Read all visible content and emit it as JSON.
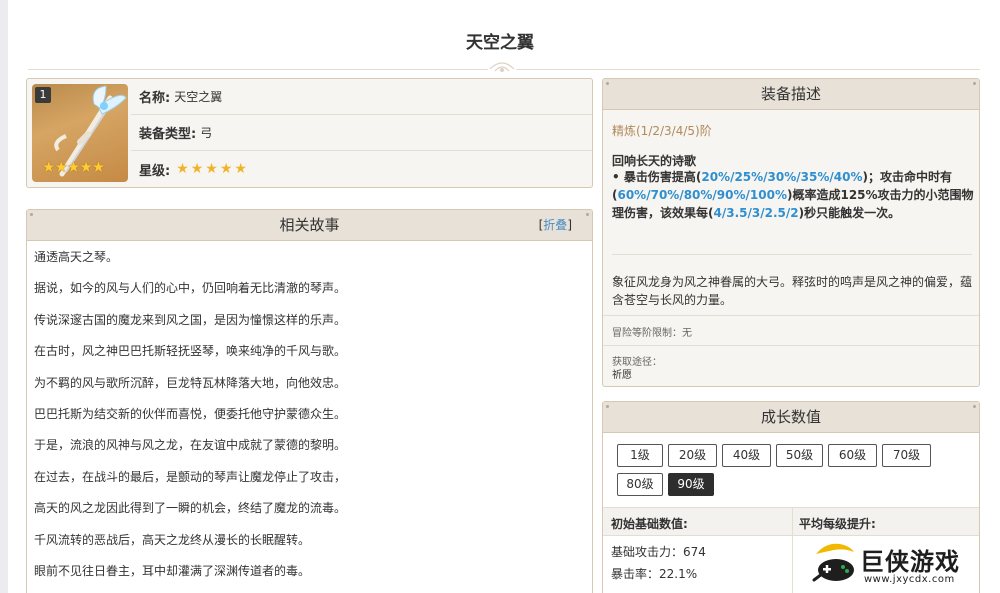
{
  "page": {
    "title": "天空之翼"
  },
  "info": {
    "level_badge": "1",
    "name_key": "名称:",
    "name_val": "天空之翼",
    "type_key": "装备类型:",
    "type_val": "弓",
    "star_key": "星级:",
    "stars": "★★★★★",
    "rarity": 5,
    "image_icon": "skyward-harp-weapon-icon"
  },
  "story": {
    "title": "相关故事",
    "fold_open": "[",
    "fold_label": "折叠",
    "fold_close": "]",
    "lines": [
      "通透高天之琴。",
      "据说，如今的风与人们的心中，仍回响着无比清澈的琴声。",
      "传说深邃古国的魔龙来到风之国，是因为憧憬这样的乐声。",
      "在古时，风之神巴巴托斯轻抚竖琴，唤来纯净的千风与歌。",
      "为不羁的风与歌所沉醉，巨龙特瓦林降落大地，向他效忠。",
      "巴巴托斯为结交新的伙伴而喜悦，便委托他守护蒙德众生。",
      "于是，流浪的风神与风之龙，在友谊中成就了蒙德的黎明。",
      "在过去，在战斗的最后，是颤动的琴声让魔龙停止了攻击，",
      "高天的风之龙因此得到了一瞬的机会，终结了魔龙的流毒。",
      "千风流转的恶战后，高天之龙终从漫长的长眠醒转。",
      "眼前不见往日眷主，耳中却灌满了深渊传道者的毒。"
    ]
  },
  "desc": {
    "title": "装备描述",
    "refine": "精炼(1/2/3/4/5)阶",
    "skill_title": "回响长天的诗歌",
    "skill_p1": "• 暴击伤害提高(",
    "skill_v1": "20%/25%/30%/35%/40%",
    "skill_p2": ")；攻击命中时有(",
    "skill_v2": "60%/70%/80%/90%/100%",
    "skill_p3": ")概率造成125%攻击力的小范围物理伤害，该效果每(",
    "skill_v3": "4/3.5/3/2.5/2",
    "skill_p4": ")秒只能触发一次。",
    "lore": "象征风龙身为风之神眷属的大弓。释弦时的鸣声是风之神的偏爱，蕴含苍空与长风的力量。",
    "limit": "冒险等阶限制：无",
    "source_label": "获取途径：",
    "source_val": "祈愿"
  },
  "growth": {
    "title": "成长数值",
    "levels": [
      "1级",
      "20级",
      "40级",
      "50级",
      "60级",
      "70级",
      "80级",
      "90级"
    ],
    "active_level": "90级",
    "col1": "初始基础数值:",
    "col2": "平均每级提升:",
    "stat1": "基础攻击力：674",
    "stat2": "暴击率：22.1%"
  },
  "watermark": {
    "brand": "巨侠游戏",
    "url": "www.jxycdx.com"
  },
  "colors": {
    "panel_border": "#d7c8b4",
    "panel_head": "#e7e1d8",
    "highlight": "#2f8fd0",
    "refine": "#b08a5a",
    "star": "#f0b429",
    "active_button": "#2e2e2e"
  }
}
